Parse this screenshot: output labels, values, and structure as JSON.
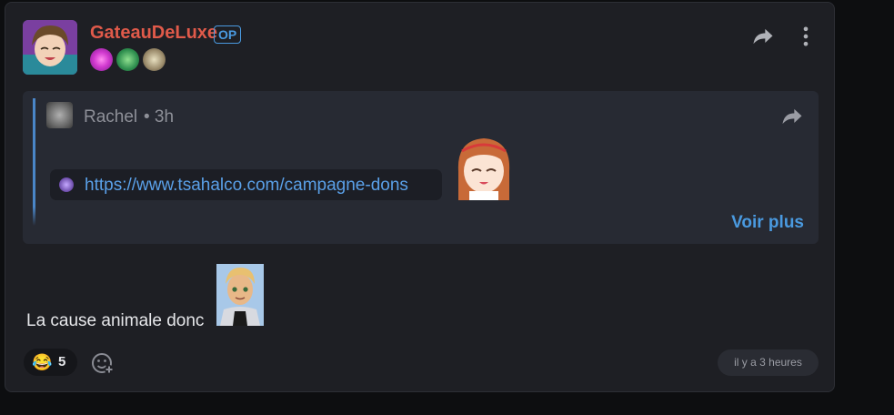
{
  "post": {
    "author": "GateauDeLuxe",
    "op_badge": "OP",
    "badges": [
      "pink-swirl-badge",
      "green-flag-badge",
      "portrait-badge"
    ],
    "actions": {
      "share_icon": "share-icon",
      "more_icon": "more-vertical-icon"
    }
  },
  "quote": {
    "author": "Rachel",
    "time": "• 3h",
    "link_url": "https://www.tsahalco.com/campagne-dons",
    "see_more": "Voir plus"
  },
  "message": {
    "text": "La cause animale donc"
  },
  "footer": {
    "reaction_emoji": "😂",
    "reaction_count": "5",
    "timestamp": "il y a 3 heures"
  },
  "colors": {
    "username": "#e05a4a",
    "accent": "#4a9ae0",
    "card_bg": "#1e1f24",
    "quote_bg": "#272a33"
  }
}
